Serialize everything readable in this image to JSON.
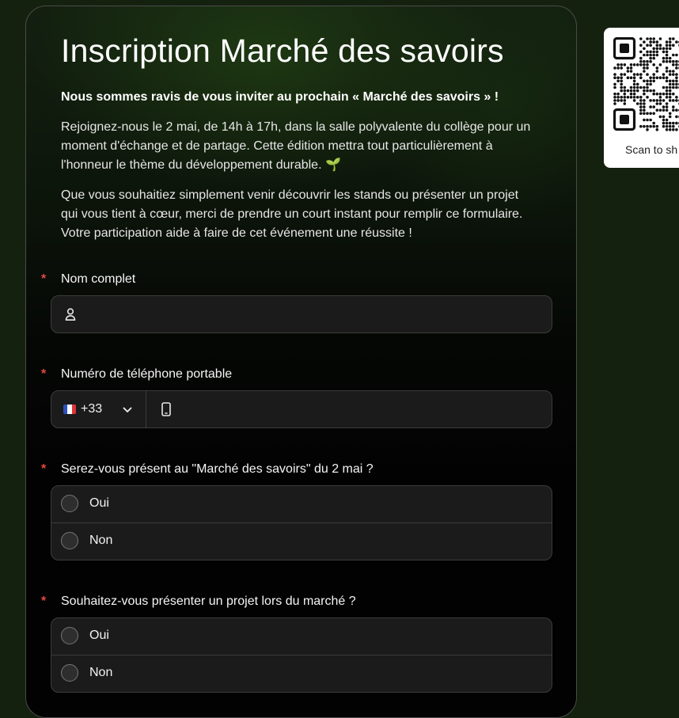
{
  "form": {
    "title": "Inscription Marché des savoirs",
    "intro_bold": "Nous sommes ravis de vous inviter au prochain « Marché des savoirs » !",
    "paragraph1": "Rejoignez-nous le 2 mai, de 14h à 17h, dans la salle polyvalente du collège pour un moment d'échange et de partage. Cette édition mettra tout particulièrement à l'honneur le thème du développement durable.",
    "paragraph1_emoji": "🌱",
    "paragraph2": "Que vous souhaitiez simplement venir découvrir les stands ou présenter un projet qui vous tient à cœur, merci de prendre un court instant pour remplir ce formulaire. Votre participation aide à faire de cet événement une réussite !",
    "required_marker": "*",
    "questions": [
      {
        "label": "Nom complet",
        "type": "text",
        "value": "",
        "placeholder": "",
        "icon": "user-icon"
      },
      {
        "label": "Numéro de téléphone portable",
        "type": "phone",
        "country_flag": "FR",
        "dial_code": "+33",
        "value": "",
        "icon": "phone-icon"
      },
      {
        "label": "Serez-vous présent au \"Marché des savoirs\" du 2 mai ?",
        "type": "radio",
        "options": [
          "Oui",
          "Non"
        ],
        "selected": null
      },
      {
        "label": "Souhaitez-vous présenter un projet lors du marché ?",
        "type": "radio",
        "options": [
          "Oui",
          "Non"
        ],
        "selected": null
      }
    ]
  },
  "qr": {
    "caption": "Scan to sh"
  },
  "colors": {
    "required": "#e5483e",
    "background": "#15210f",
    "field_bg": "#1b1b1b",
    "field_border": "#3c3c3c"
  }
}
